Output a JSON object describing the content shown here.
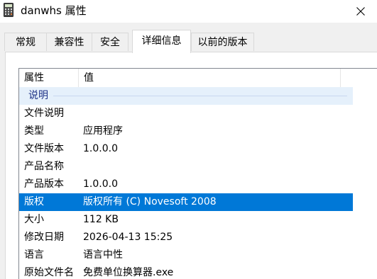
{
  "window": {
    "title": "danwhs 属性",
    "icon": "calculator-icon"
  },
  "tabs": [
    {
      "label": "常规",
      "active": false
    },
    {
      "label": "兼容性",
      "active": false
    },
    {
      "label": "安全",
      "active": false
    },
    {
      "label": "详细信息",
      "active": true
    },
    {
      "label": "以前的版本",
      "active": false
    }
  ],
  "details": {
    "headers": {
      "property": "属性",
      "value": "值"
    },
    "group_label": "说明",
    "rows": [
      {
        "name": "文件说明",
        "value": ""
      },
      {
        "name": "类型",
        "value": "应用程序"
      },
      {
        "name": "文件版本",
        "value": "1.0.0.0"
      },
      {
        "name": "产品名称",
        "value": ""
      },
      {
        "name": "产品版本",
        "value": "1.0.0.0"
      },
      {
        "name": "版权",
        "value": "版权所有 (C) Novesoft 2008",
        "selected": true
      },
      {
        "name": "大小",
        "value": "112 KB"
      },
      {
        "name": "修改日期",
        "value": "2026-04-13 15:25"
      },
      {
        "name": "语言",
        "value": "语言中性"
      },
      {
        "name": "原始文件名",
        "value": "免费单位换算器.exe"
      }
    ]
  },
  "colors": {
    "selection": "#0078d7",
    "group_background": "#e5f0fb",
    "group_text": "#1e3287"
  }
}
